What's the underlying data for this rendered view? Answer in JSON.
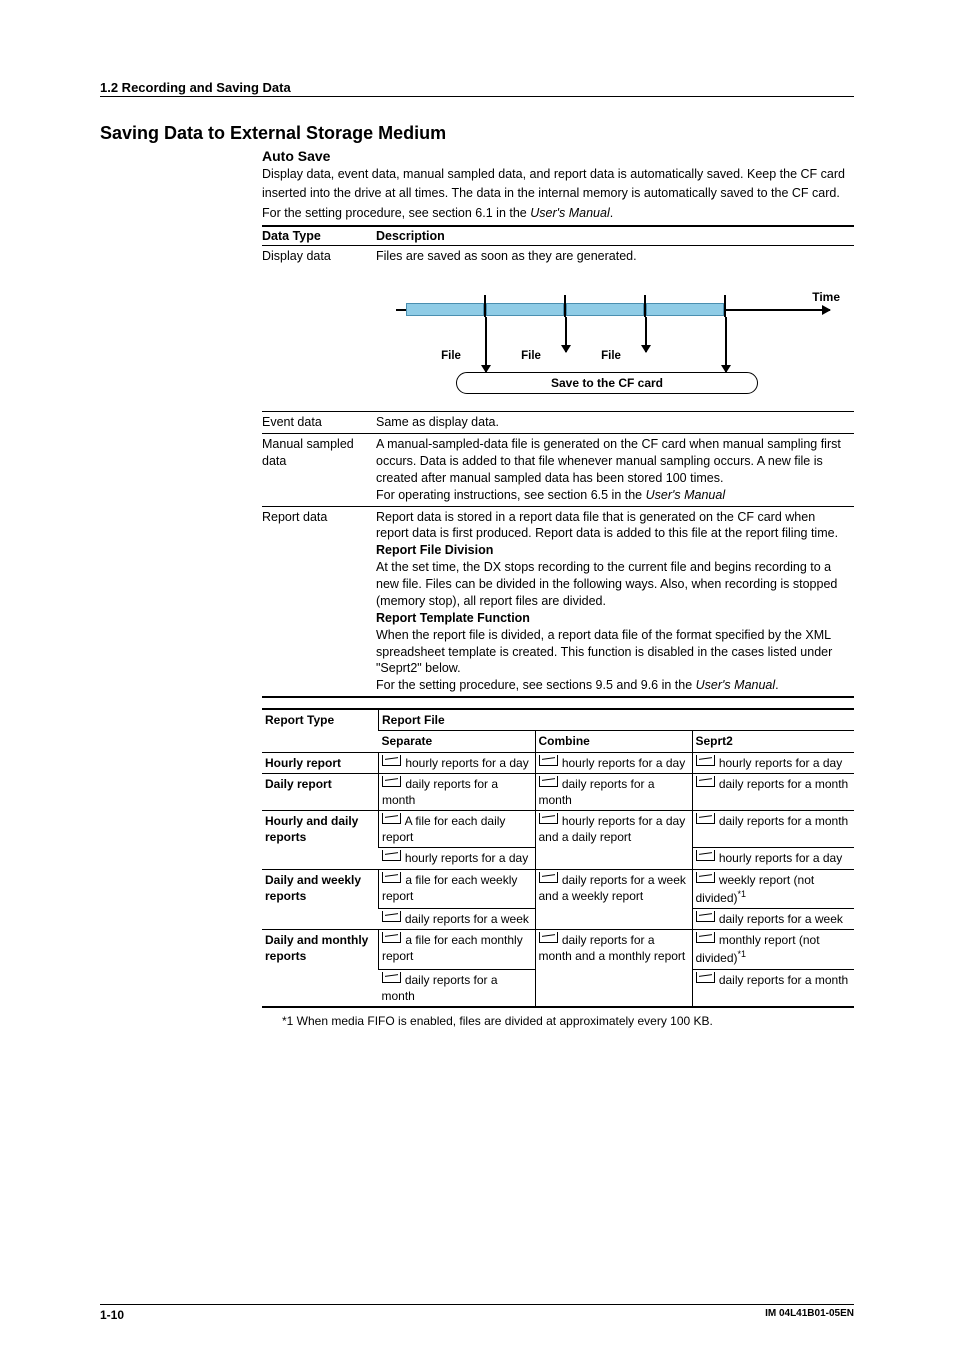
{
  "header": {
    "section": "1.2  Recording and Saving Data"
  },
  "heading": "Saving Data to External Storage Medium",
  "autosave": {
    "title": "Auto Save",
    "p1": "Display data, event data, manual sampled data, and report data is automatically saved. Keep the CF card inserted into the drive at all times. The data in the internal memory is automatically saved to the CF card.",
    "p2_prefix": "For the setting procedure, see section 6.1 in the ",
    "p2_italic": "User's Manual",
    "p2_suffix": "."
  },
  "datatype_table": {
    "headers": {
      "type": "Data Type",
      "desc": "Description"
    },
    "rows": {
      "display": {
        "type": "Display data",
        "desc": "Files are saved as soon as they are generated."
      },
      "event": {
        "type": "Event data",
        "desc": "Same as display data."
      },
      "manual": {
        "type1": "Manual sampled",
        "type2": "data",
        "p1": "A manual-sampled-data file is generated on the CF card when manual sampling first occurs. Data is added to that file whenever manual sampling occurs. A new file is created after manual sampled data has been stored 100 times.",
        "p2_prefix": "For operating instructions, see section 6.5 in the ",
        "p2_italic": "User's Manual"
      },
      "report": {
        "type": "Report data",
        "p1": "Report data is stored in a report data file that is generated on the CF card when report data is first produced. Report data is added to this file at the report filing time.",
        "h1": "Report File Division",
        "p2": "At the set time, the DX stops recording to the current file and begins recording to a new file. Files can be divided in the following ways. Also, when recording is stopped (memory stop), all report files are divided.",
        "h2": "Report Template Function",
        "p3": "When the report file is divided, a report data file of the format specified by the XML spreadsheet template is created. This function is disabled in the cases listed under \"Seprt2\" below.",
        "p4_prefix": "For the setting procedure, see sections 9.5 and 9.6 in the ",
        "p4_italic": "User's Manual",
        "p4_suffix": "."
      }
    }
  },
  "diagram": {
    "time": "Time",
    "file": "File",
    "save": "Save to the CF card"
  },
  "report_table": {
    "headers": {
      "type": "Report Type",
      "file": "Report File",
      "separate": "Separate",
      "combine": "Combine",
      "seprt2": "Seprt2"
    },
    "rows": {
      "hourly": {
        "type": "Hourly report",
        "sep": " hourly reports for a day",
        "com": " hourly reports for a day",
        "s2": " hourly reports for a day"
      },
      "daily": {
        "type": "Daily report",
        "sep": " daily reports for a month",
        "com": " daily reports for a month",
        "s2": " daily reports for a month"
      },
      "hd": {
        "type": "Hourly and daily reports",
        "sep1": " A file for each daily report",
        "sep2": " hourly reports for a day",
        "com": " hourly reports for a day and a daily report",
        "s21": " daily reports for a month",
        "s22": " hourly reports for a day"
      },
      "dw": {
        "type": "Daily and weekly reports",
        "sep1": " a file for each weekly report",
        "sep2": " daily reports for a week",
        "com": " daily reports for a week and a weekly report",
        "s21": " weekly report (not divided)",
        "s22": " daily reports for a week"
      },
      "dm": {
        "type": "Daily and monthly reports",
        "sep1": " a file for each monthly report",
        "sep2": " daily reports for a month",
        "com": " daily reports for a month and a monthly report",
        "s21": " monthly report (not divided)",
        "s22": " daily reports for a month"
      }
    }
  },
  "footnote_label": "*1",
  "footnote": "*1  When media FIFO is enabled, files are divided at approximately every 100 KB.",
  "footer": {
    "page": "1-10",
    "code": "IM 04L41B01-05EN"
  }
}
